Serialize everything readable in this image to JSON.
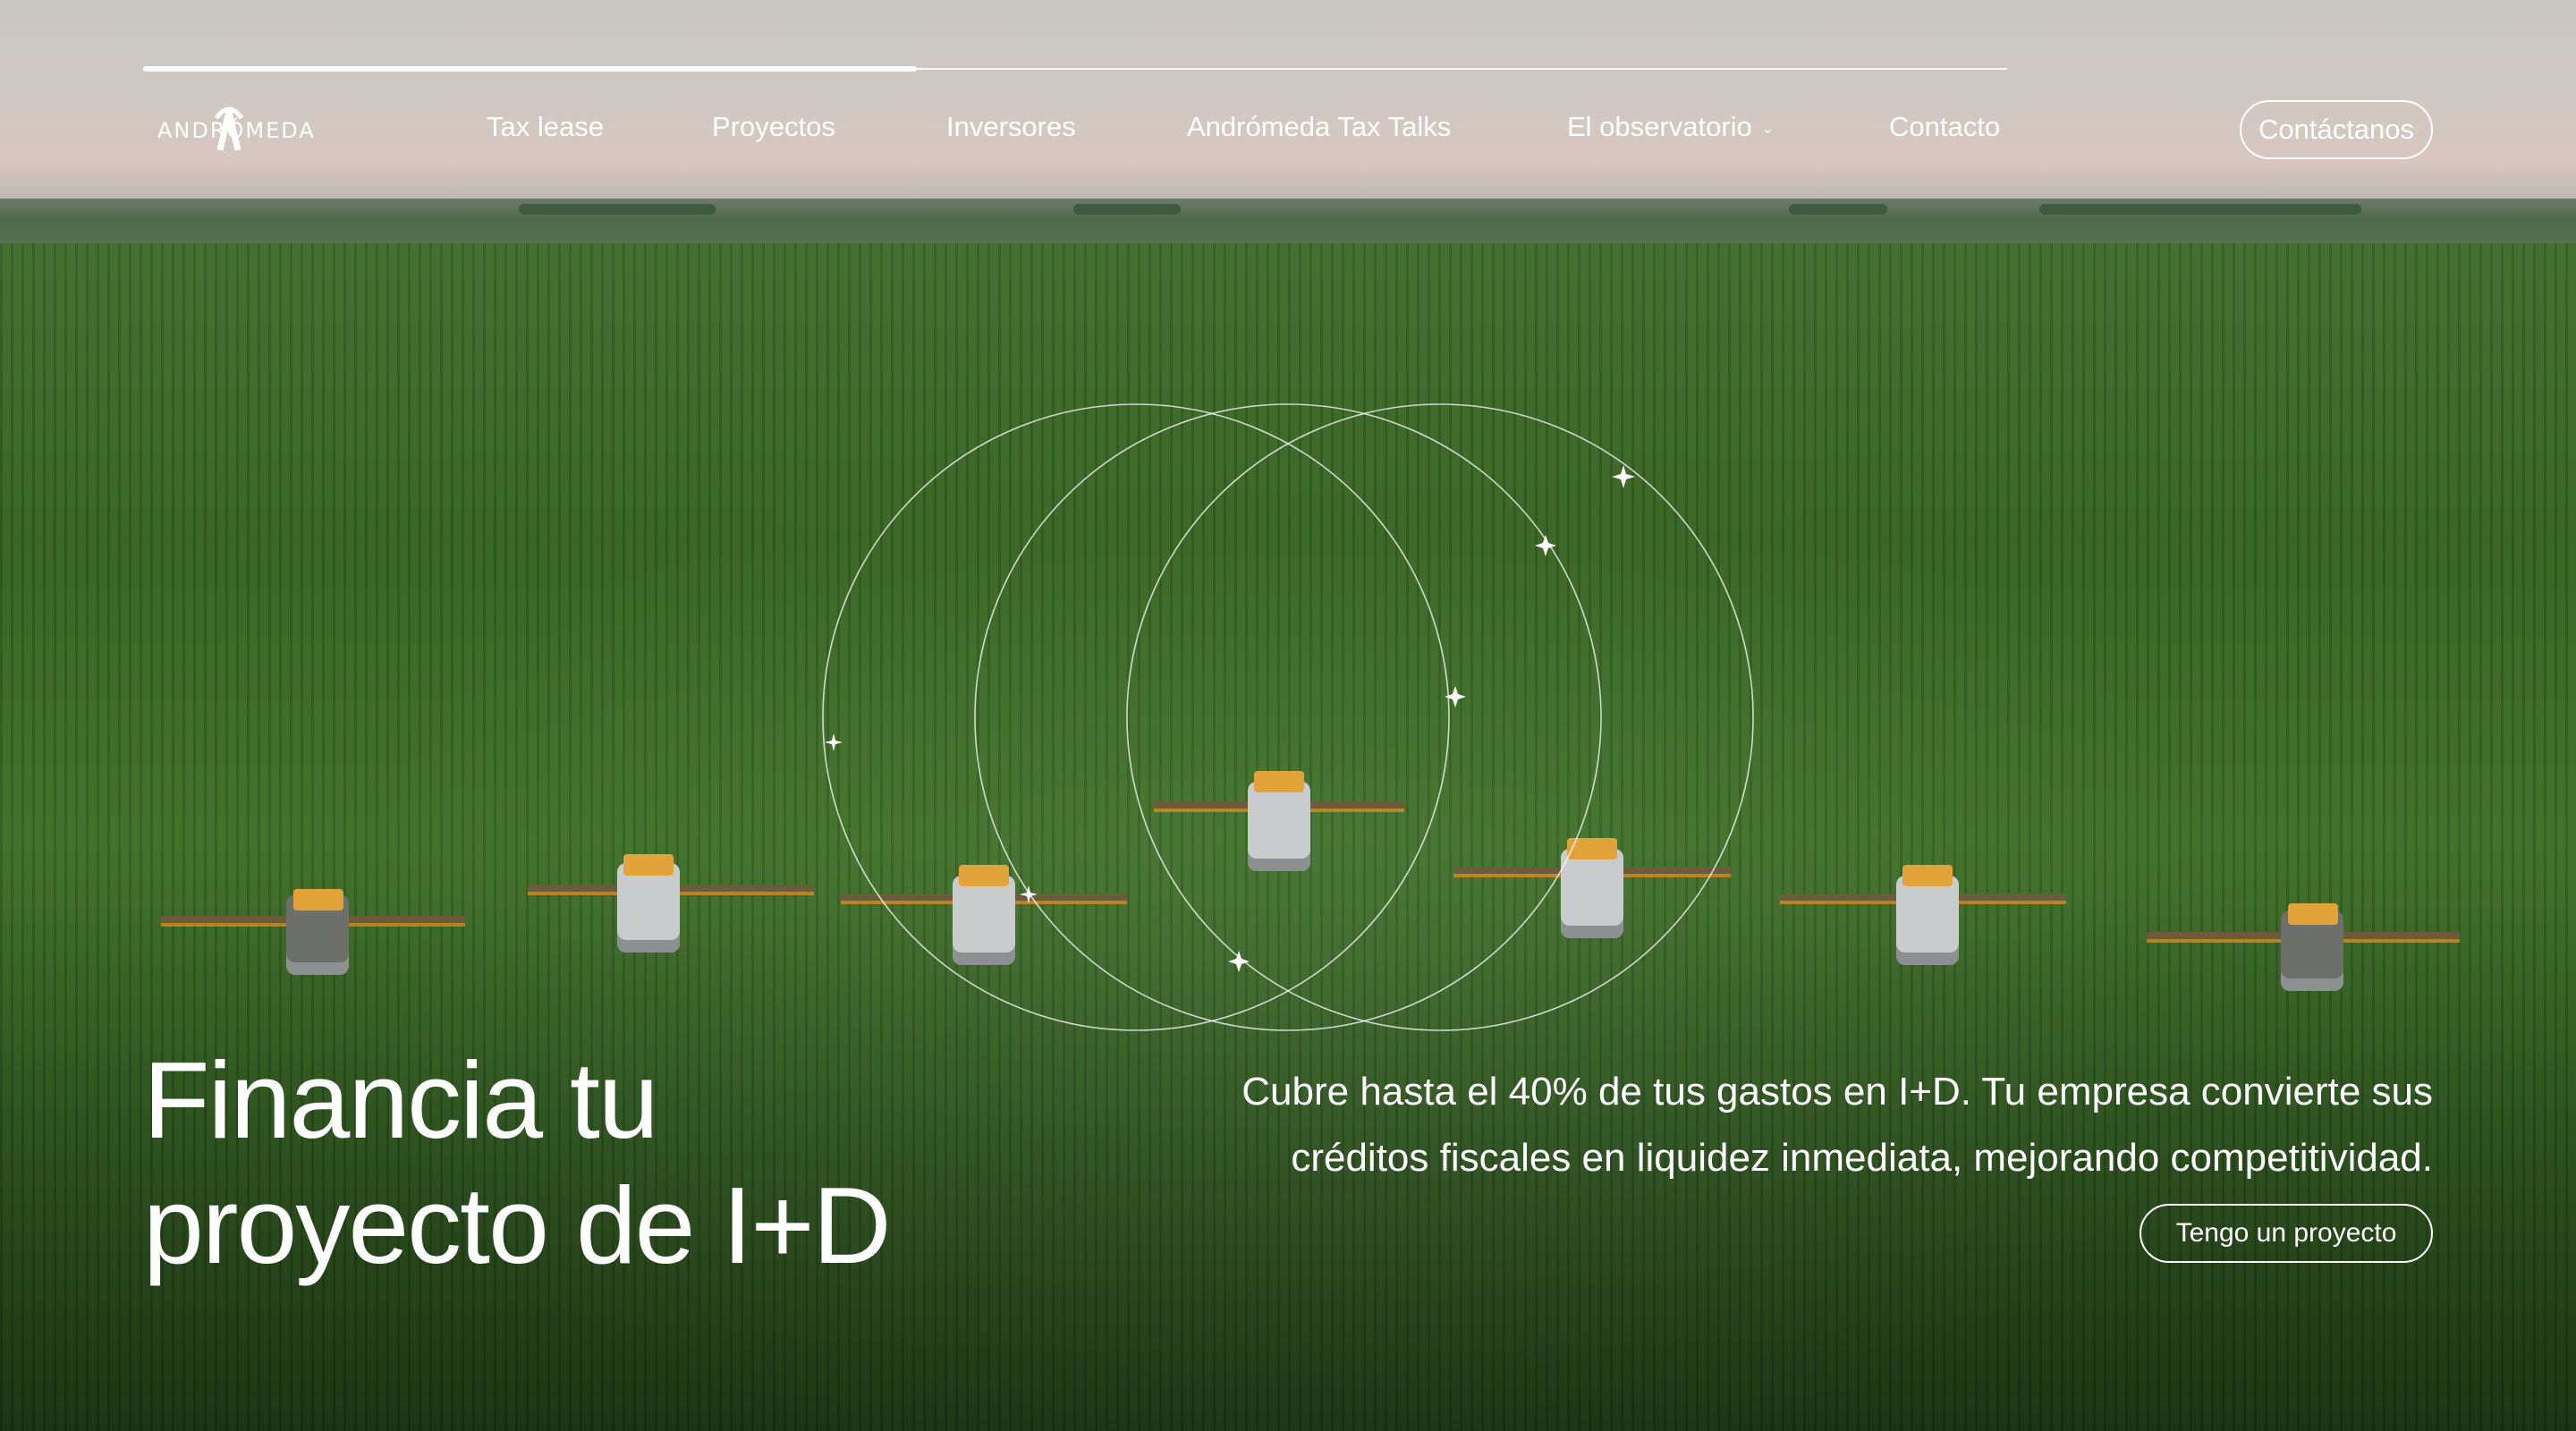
{
  "brand": {
    "name": "ANDRÓMEDA"
  },
  "header": {
    "progress_fraction": 0.415,
    "nav": [
      {
        "label": "Tax lease"
      },
      {
        "label": "Proyectos"
      },
      {
        "label": "Inversores"
      },
      {
        "label": "Andrómeda Tax Talks"
      },
      {
        "label": "El observatorio",
        "has_dropdown": true,
        "icon": "chevron-down-icon"
      },
      {
        "label": "Contacto"
      }
    ],
    "cta_label": "Contáctanos"
  },
  "hero": {
    "title_line1": "Financia tu",
    "title_line2": "proyecto de I+D",
    "description_line1": "Cubre hasta el 40% de tus gastos en I+D. Tu empresa convierte sus",
    "description_line2": "créditos fiscales en liquidez inmediata, mejorando competitividad.",
    "cta_label": "Tengo un proyecto"
  },
  "colors": {
    "text": "#ffffff",
    "field_green": "#35621f",
    "sky": "#cfc8c2",
    "tractor_accent": "#e2a33b"
  }
}
